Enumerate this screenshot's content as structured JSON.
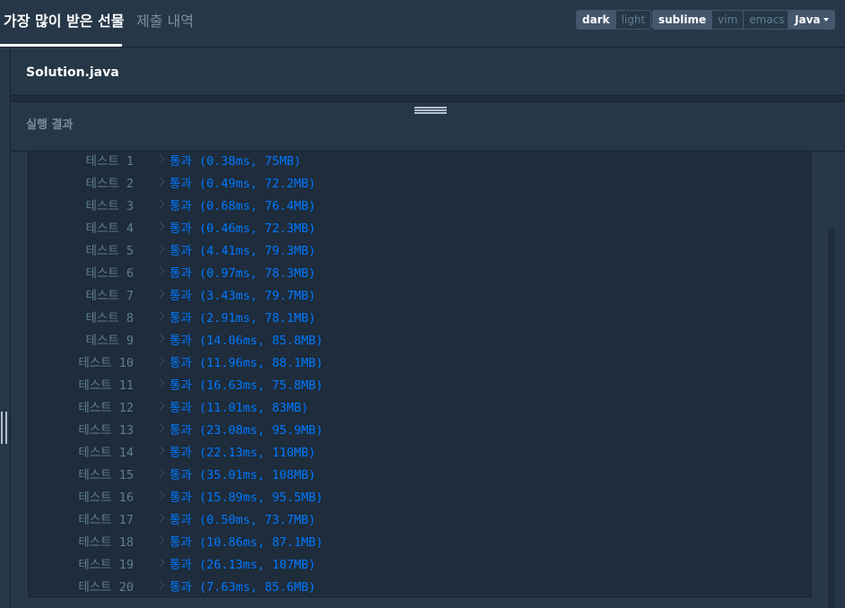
{
  "header": {
    "tabs": [
      {
        "label": "가장 많이 받은 선물",
        "active": true
      },
      {
        "label": "제출 내역",
        "active": false
      }
    ],
    "theme_buttons": [
      "dark",
      "light"
    ],
    "keymap_buttons": [
      "sublime",
      "vim",
      "emacs"
    ],
    "language": "Java"
  },
  "editor": {
    "file_name": "Solution.java"
  },
  "result": {
    "title": "실행 결과",
    "tests": [
      {
        "label": "테스트 1",
        "result": "통과 (0.38ms, 75MB)"
      },
      {
        "label": "테스트 2",
        "result": "통과 (0.49ms, 72.2MB)"
      },
      {
        "label": "테스트 3",
        "result": "통과 (0.68ms, 76.4MB)"
      },
      {
        "label": "테스트 4",
        "result": "통과 (0.46ms, 72.3MB)"
      },
      {
        "label": "테스트 5",
        "result": "통과 (4.41ms, 79.3MB)"
      },
      {
        "label": "테스트 6",
        "result": "통과 (0.97ms, 78.3MB)"
      },
      {
        "label": "테스트 7",
        "result": "통과 (3.43ms, 79.7MB)"
      },
      {
        "label": "테스트 8",
        "result": "통과 (2.91ms, 78.1MB)"
      },
      {
        "label": "테스트 9",
        "result": "통과 (14.06ms, 85.8MB)"
      },
      {
        "label": "테스트 10",
        "result": "통과 (11.96ms, 88.1MB)"
      },
      {
        "label": "테스트 11",
        "result": "통과 (16.63ms, 75.8MB)"
      },
      {
        "label": "테스트 12",
        "result": "통과 (11.01ms, 83MB)"
      },
      {
        "label": "테스트 13",
        "result": "통과 (23.08ms, 95.9MB)"
      },
      {
        "label": "테스트 14",
        "result": "통과 (22.13ms, 110MB)"
      },
      {
        "label": "테스트 15",
        "result": "통과 (35.01ms, 108MB)"
      },
      {
        "label": "테스트 16",
        "result": "통과 (15.89ms, 95.5MB)"
      },
      {
        "label": "테스트 17",
        "result": "통과 (0.50ms, 73.7MB)"
      },
      {
        "label": "테스트 18",
        "result": "통과 (10.86ms, 87.1MB)"
      },
      {
        "label": "테스트 19",
        "result": "통과 (26.13ms, 107MB)"
      },
      {
        "label": "테스트 20",
        "result": "통과 (7.63ms, 85.6MB)"
      }
    ]
  },
  "icons": {
    "rail_handle": "drag-handle-icon",
    "splitter": "splitter-handle-icon",
    "chevron": "chevron-right-icon",
    "caret": "caret-down-icon"
  },
  "colors": {
    "background": "#263747",
    "console": "#1e2c3b",
    "pass": "#0078ff",
    "label": "#5f7f90"
  }
}
